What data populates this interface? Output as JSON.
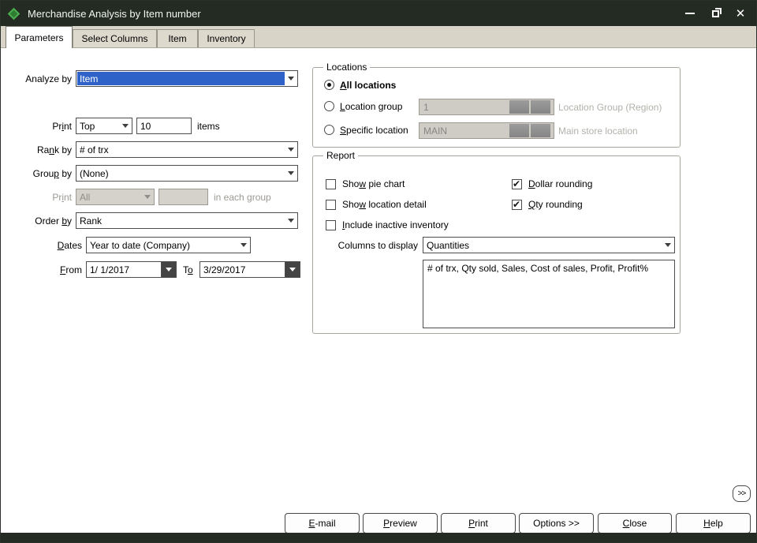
{
  "window": {
    "title": "Merchandise Analysis by Item number"
  },
  "tabs": {
    "parameters": "Parameters",
    "select_columns": "Select Columns",
    "item": "Item",
    "inventory": "Inventory"
  },
  "form": {
    "analyze_by_label": "Analyze by",
    "analyze_by_value": "Item",
    "print_label": {
      "text": "Print",
      "u": 2
    },
    "print_range_value": "Top",
    "print_count": "10",
    "items_suffix": "items",
    "rank_by_label": {
      "text": "Rank by",
      "u": 2
    },
    "rank_by_value": "# of trx",
    "group_by_label": {
      "text": "Group by",
      "u": 4
    },
    "group_by_value": "(None)",
    "print_group_label": {
      "text": "Print",
      "u": 2
    },
    "print_group_value": "All",
    "print_group_suffix": "in each group",
    "order_by_label": {
      "text": "Order by",
      "u": 6
    },
    "order_by_value": "Rank",
    "dates_label": {
      "text": "Dates",
      "u": 0
    },
    "dates_value": "Year to date (Company)",
    "from_label": {
      "text": "From",
      "u": 0
    },
    "from_value": "1/ 1/2017",
    "to_label": {
      "text": "To",
      "u": 1
    },
    "to_value": "3/29/2017"
  },
  "locations": {
    "title": "Locations",
    "all_locations_label": {
      "text": "All locations",
      "u": 0
    },
    "all_locations_selected": true,
    "location_group_label": {
      "text": "Location group",
      "u": 0
    },
    "location_group_value": "1",
    "location_group_hint": "Location Group (Region)",
    "specific_location_label": {
      "text": "Specific location",
      "u": 0
    },
    "specific_location_value": "MAIN",
    "specific_location_hint": "Main store location"
  },
  "report": {
    "title": "Report",
    "show_pie_chart_label": {
      "text": "Show pie chart",
      "u": 3
    },
    "show_pie_chart_checked": false,
    "show_location_detail_label": {
      "text": "Show location detail",
      "u": 3
    },
    "show_location_detail_checked": false,
    "include_inactive_label": {
      "text": "Include inactive inventory",
      "u": 0
    },
    "include_inactive_checked": false,
    "dollar_rounding_label": {
      "text": "Dollar rounding",
      "u": 0
    },
    "dollar_rounding_checked": true,
    "qty_rounding_label": {
      "text": "Qty rounding",
      "u": 0
    },
    "qty_rounding_checked": true,
    "columns_label": "Columns to display",
    "columns_value": "Quantities",
    "columns_detail": "# of trx, Qty sold, Sales, Cost of sales, Profit, Profit%"
  },
  "expand_button": ">>",
  "buttons": [
    {
      "text": "E-mail",
      "u": 0
    },
    {
      "text": "Preview",
      "u": 0
    },
    {
      "text": "Print",
      "u": 0
    },
    {
      "text": "Options >>"
    },
    {
      "text": "Close",
      "u": 0
    },
    {
      "text": "Help",
      "u": 0
    }
  ]
}
